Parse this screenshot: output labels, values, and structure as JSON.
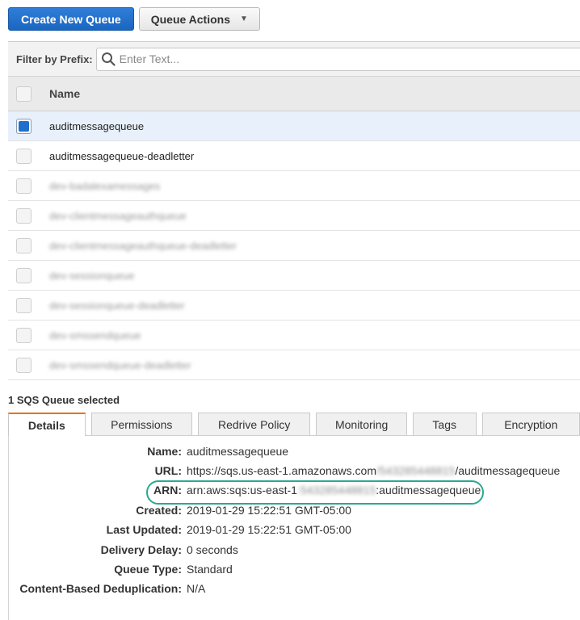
{
  "toolbar": {
    "create_label": "Create New Queue",
    "actions_label": "Queue Actions"
  },
  "filter": {
    "label": "Filter by Prefix:",
    "placeholder": "Enter Text..."
  },
  "table": {
    "name_header": "Name",
    "rows": [
      {
        "name": "auditmessagequeue",
        "selected": true
      },
      {
        "name": "auditmessagequeue-deadletter",
        "selected": false
      },
      {
        "name": "dev-badalexamessages",
        "selected": false
      },
      {
        "name": "dev-clientmessageauthqueue",
        "selected": false
      },
      {
        "name": "dev-clientmessageauthqueue-deadletter",
        "selected": false
      },
      {
        "name": "dev-sessionqueue",
        "selected": false
      },
      {
        "name": "dev-sessionqueue-deadletter",
        "selected": false
      },
      {
        "name": "dev-smssendqueue",
        "selected": false
      },
      {
        "name": "dev-smssendqueue-deadletter",
        "selected": false
      }
    ]
  },
  "selection_count": "1 SQS Queue selected",
  "tabs": [
    "Details",
    "Permissions",
    "Redrive Policy",
    "Monitoring",
    "Tags",
    "Encryption"
  ],
  "details": {
    "name_label": "Name:",
    "name_value": "auditmessagequeue",
    "url_label": "URL:",
    "url_prefix": "https://sqs.us-east-1.amazonaws.com",
    "url_account": "/543285448815",
    "url_suffix": "/auditmessagequeue",
    "arn_label": "ARN:",
    "arn_prefix": "arn:aws:sqs:us-east-1",
    "arn_account": ":543285448815",
    "arn_suffix": ":auditmessagequeue",
    "created_label": "Created:",
    "created_value": "2019-01-29 15:22:51 GMT-05:00",
    "updated_label": "Last Updated:",
    "updated_value": "2019-01-29 15:22:51 GMT-05:00",
    "delay_label": "Delivery Delay:",
    "delay_value": "0 seconds",
    "type_label": "Queue Type:",
    "type_value": "Standard",
    "dedup_label": "Content-Based Deduplication:",
    "dedup_value": "N/A"
  },
  "colors": {
    "primary": "#1a66c0",
    "selected_row": "#e8f1fb",
    "active_tab": "#ec7211",
    "highlight": "#2aa98f"
  }
}
